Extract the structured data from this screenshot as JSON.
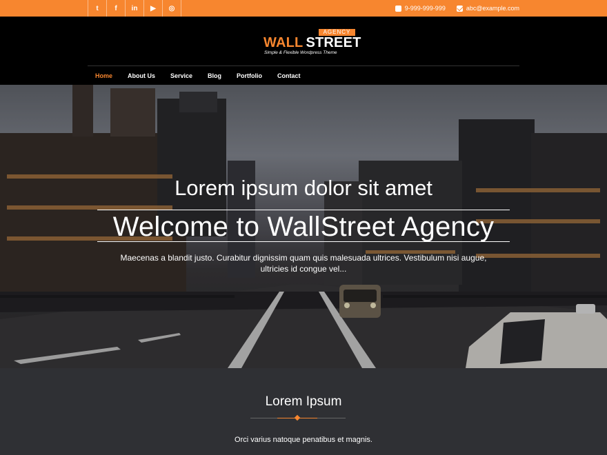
{
  "topbar": {
    "social": [
      {
        "icon": "twitter-icon",
        "glyph": "t"
      },
      {
        "icon": "facebook-icon",
        "glyph": "f"
      },
      {
        "icon": "linkedin-icon",
        "glyph": "in"
      },
      {
        "icon": "youtube-icon",
        "glyph": "▶"
      },
      {
        "icon": "instagram-icon",
        "glyph": "◎"
      }
    ],
    "phone": "9-999-999-999",
    "email": "abc@example.com"
  },
  "logo": {
    "tag": "AGENCY",
    "word1": "WALL",
    "word2": "STREET",
    "tagline": "Simple & Flexible Wordpress Theme"
  },
  "nav": [
    "Home",
    "About Us",
    "Service",
    "Blog",
    "Portfolio",
    "Contact"
  ],
  "hero": {
    "subtitle": "Lorem ipsum dolor sit amet",
    "title": "Welcome to WallStreet Agency",
    "description": "Maecenas a blandit justo. Curabitur dignissim quam quis malesuada ultrices. Vestibulum nisi augue, ultricies id congue vel..."
  },
  "section": {
    "title": "Lorem Ipsum",
    "text": "Orci varius natoque penatibus et magnis."
  },
  "colors": {
    "accent": "#f7862f",
    "header_bg": "#000000",
    "section_bg": "#2f3034"
  }
}
